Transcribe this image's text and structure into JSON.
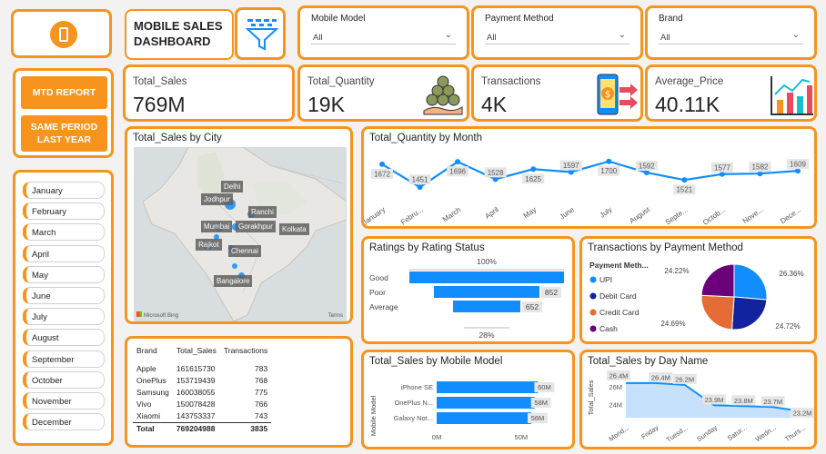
{
  "app": {
    "title": "MOBILE SALES DASHBOARD",
    "icons": [
      "phone-icon",
      "filter-funnel-icon",
      "coins-hand-icon",
      "mobile-payment-icon",
      "bar-chart-icon"
    ]
  },
  "slicers": [
    {
      "label": "Mobile Model",
      "value": "All"
    },
    {
      "label": "Payment Method",
      "value": "All"
    },
    {
      "label": "Brand",
      "value": "All"
    }
  ],
  "kpis": [
    {
      "label": "Total_Sales",
      "value": "769M"
    },
    {
      "label": "Total_Quantity",
      "value": "19K"
    },
    {
      "label": "Transactions",
      "value": "4K"
    },
    {
      "label": "Average_Price",
      "value": "40.11K"
    }
  ],
  "buttons": {
    "mtd": "MTD REPORT",
    "same_period": "SAME PERIOD LAST YEAR"
  },
  "months": [
    "January",
    "February",
    "March",
    "April",
    "May",
    "June",
    "July",
    "August",
    "September",
    "October",
    "November",
    "December"
  ],
  "colors": {
    "accent": "#f7941d",
    "primary": "#118dff",
    "navy": "#12239e",
    "orange": "#e66c37",
    "purple": "#6b007b"
  },
  "map": {
    "title": "Total_Sales by City",
    "cities": [
      "Delhi",
      "Jodhpur",
      "Ranchi",
      "Mumbai",
      "Gorakhpur",
      "Kolkata",
      "Rajkot",
      "Chennai",
      "Bangalore"
    ],
    "credit_left": "Microsoft Bing",
    "credit_right": "Terms"
  },
  "brand_table": {
    "headers": [
      "Brand",
      "Total_Sales",
      "Transactions"
    ],
    "rows": [
      [
        "Apple",
        "161615730",
        "783"
      ],
      [
        "OnePlus",
        "153719439",
        "768"
      ],
      [
        "Samsung",
        "160038055",
        "775"
      ],
      [
        "Vivo",
        "150078428",
        "766"
      ],
      [
        "Xiaomi",
        "143753337",
        "743"
      ]
    ],
    "total": [
      "Total",
      "769204988",
      "3835"
    ]
  },
  "chart_data": [
    {
      "type": "line",
      "title": "Total_Quantity by Month",
      "categories": [
        "January",
        "Febru...",
        "March",
        "April",
        "May",
        "June",
        "July",
        "August",
        "Septe...",
        "Octob...",
        "Nove...",
        "Dece..."
      ],
      "values": [
        1672,
        1451,
        1696,
        1528,
        1625,
        1597,
        1700,
        1592,
        1521,
        1577,
        1582,
        1609
      ],
      "labels": [
        "1672",
        "1451",
        "1696",
        "1528",
        "1625",
        "1597",
        "1700",
        "1592",
        "1521",
        "1577",
        "1582",
        "1609"
      ],
      "ylim": [
        1400,
        1750
      ],
      "color": "#118dff"
    },
    {
      "type": "bar",
      "title": "Ratings by Rating Status",
      "categories": [
        "Good",
        "Poor",
        "Average"
      ],
      "values": [
        100,
        852,
        652
      ],
      "labels": [
        "",
        "852",
        "652"
      ],
      "top_label": "100%",
      "bottom_label": "28%",
      "color": "#118dff"
    },
    {
      "type": "pie",
      "title": "Transactions by Payment Method",
      "legend_title": "Payment Meth...",
      "categories": [
        "UPI",
        "Debit Card",
        "Credit Card",
        "Cash"
      ],
      "values": [
        26.36,
        24.72,
        24.69,
        24.22
      ],
      "labels": [
        "26.36%",
        "24.72%",
        "24.69%",
        "24.22%"
      ],
      "colors": [
        "#118dff",
        "#12239e",
        "#e66c37",
        "#6b007b"
      ]
    },
    {
      "type": "bar",
      "title": "Total_Sales by Mobile Model",
      "ylabel": "Mobile Model",
      "categories": [
        "iPhone SE",
        "OnePlus N...",
        "Galaxy Not..."
      ],
      "values": [
        60,
        58,
        56
      ],
      "labels": [
        "60M",
        "58M",
        "56M"
      ],
      "xticks": [
        "0M",
        "50M"
      ],
      "xlim": [
        0,
        70
      ],
      "color": "#118dff"
    },
    {
      "type": "area",
      "title": "Total_Sales by Day Name",
      "ylabel": "Total_Sales",
      "categories": [
        "Mond...",
        "Friday",
        "Tuesd...",
        "Sunday",
        "Satur...",
        "Wedn...",
        "Thurs..."
      ],
      "values": [
        26.4,
        26.4,
        26.2,
        23.9,
        23.8,
        23.7,
        23.2
      ],
      "labels": [
        "26.4M",
        "26.4M",
        "26.2M",
        "23.9M",
        "23.8M",
        "23.7M",
        "23.2M"
      ],
      "yticks": [
        "26M",
        "24M"
      ],
      "ylim": [
        22.5,
        27
      ],
      "color": "#118dff"
    }
  ]
}
